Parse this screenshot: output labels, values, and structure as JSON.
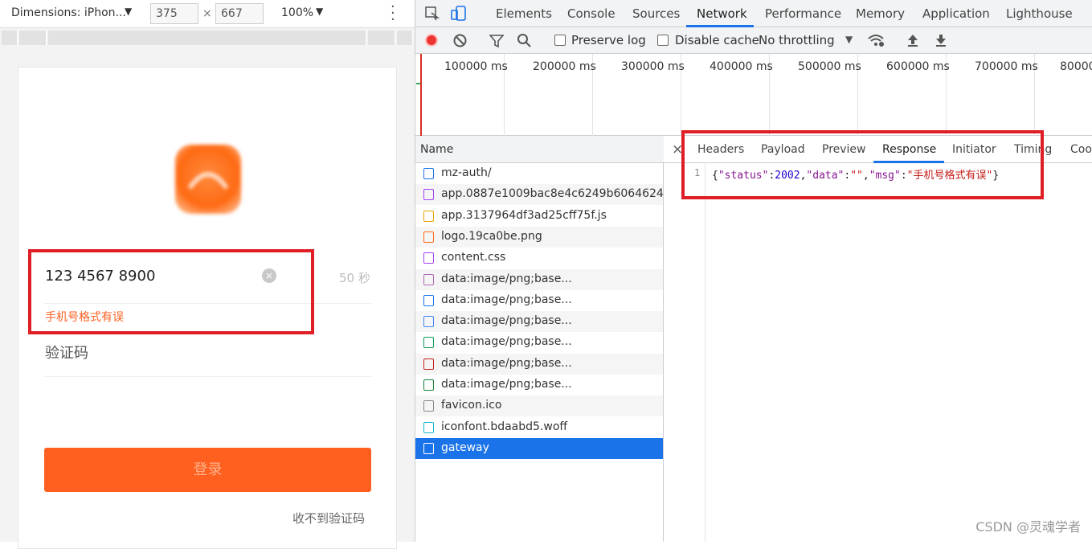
{
  "device": {
    "dimensions_label": "Dimensions: iPhon...",
    "width": "375",
    "times": "×",
    "height": "667",
    "zoom": "100%",
    "phone_value": "123 4567 8900",
    "countdown": "50 秒",
    "error": "手机号格式有误",
    "code_placeholder": "验证码",
    "login": "登录",
    "no_code": "收不到验证码"
  },
  "devtools": {
    "tabs": [
      "Elements",
      "Console",
      "Sources",
      "Network",
      "Performance",
      "Memory",
      "Application",
      "Lighthouse"
    ],
    "active_tab": "Network",
    "preserve_log": "Preserve log",
    "disable_cache": "Disable cache",
    "throttling": "No throttling",
    "timeline_ticks": [
      "100000 ms",
      "200000 ms",
      "300000 ms",
      "400000 ms",
      "500000 ms",
      "600000 ms",
      "700000 ms",
      "80000"
    ],
    "name_header": "Name",
    "requests": [
      {
        "name": "mz-auth/",
        "icon": "document-icon",
        "color": "#1a73e8"
      },
      {
        "name": "app.0887e1009bac8e4c6249b6064624...",
        "icon": "stylesheet-icon",
        "color": "#a142f4"
      },
      {
        "name": "app.3137964df3ad25cff75f.js",
        "icon": "script-icon",
        "color": "#e8a400"
      },
      {
        "name": "logo.19ca0be.png",
        "icon": "image-icon",
        "color": "#ff6a13"
      },
      {
        "name": "content.css",
        "icon": "stylesheet-icon",
        "color": "#a142f4"
      },
      {
        "name": "data:image/png;base...",
        "icon": "image-icon",
        "color": "#b06ab3"
      },
      {
        "name": "data:image/png;base...",
        "icon": "image-icon",
        "color": "#1a73e8"
      },
      {
        "name": "data:image/png;base...",
        "icon": "image-icon",
        "color": "#4285f4"
      },
      {
        "name": "data:image/png;base...",
        "icon": "image-icon",
        "color": "#0f9d58"
      },
      {
        "name": "data:image/png;base...",
        "icon": "image-icon",
        "color": "#c5221f"
      },
      {
        "name": "data:image/png;base...",
        "icon": "image-icon",
        "color": "#188038"
      },
      {
        "name": "favicon.ico",
        "icon": "file-icon",
        "color": "#888888"
      },
      {
        "name": "iconfont.bdaabd5.woff",
        "icon": "font-icon",
        "color": "#12b5cb"
      },
      {
        "name": "gateway",
        "icon": "file-icon",
        "color": "#ffffff"
      }
    ],
    "selected": "gateway",
    "close": "×",
    "detail_tabs": [
      "Headers",
      "Payload",
      "Preview",
      "Response",
      "Initiator",
      "Timing",
      "Coo"
    ],
    "active_detail_tab": "Response",
    "line_number": "1",
    "response": {
      "open": "{",
      "k1": "\"status\"",
      "colon": ":",
      "v1": "2002",
      "comma": ",",
      "k2": "\"data\"",
      "v2": "\"\"",
      "k3": "\"msg\"",
      "v3": "\"手机号格式有误\"",
      "close": "}"
    }
  },
  "watermark": "CSDN @灵魂学者",
  "colors": {
    "accent": "#1a73e8",
    "brand": "#ff5f1f",
    "error": "#ff5f1f",
    "highlight_box": "#e01e26"
  }
}
